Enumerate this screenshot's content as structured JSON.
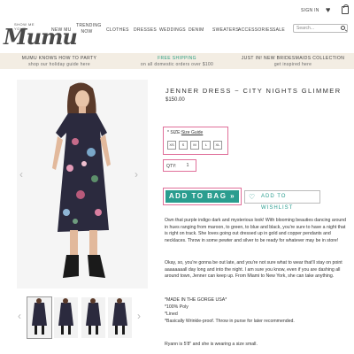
{
  "brand": {
    "logo_text": "Mumu",
    "tagline": "SHOW ME YOUR"
  },
  "nav": {
    "items": [
      "NEW MU",
      "TRENDING NOW",
      "CLOTHES",
      "DRESSES",
      "WEDDINGS",
      "DENIM",
      "SWEATERS",
      "ACCESSORIES",
      "SALE"
    ]
  },
  "utility": {
    "sign_in": "SIGN IN",
    "search_placeholder": "Search..."
  },
  "promo": [
    {
      "title": "MUMU KNOWS HOW TO PARTY",
      "subtitle": "shop our holiday guide here"
    },
    {
      "title": "FREE SHIPPING",
      "subtitle": "on all domestic orders over $100"
    },
    {
      "title": "JUST IN! NEW BRIDESMAIDS COLLECTION",
      "subtitle": "get inspired here"
    }
  ],
  "product": {
    "title": "JENNER DRESS ~ CITY NIGHTS GLIMMER",
    "price": "$150.00",
    "size_label": "* SIZE:",
    "size_guide": "Size Guide",
    "sizes": [
      "XS",
      "S",
      "M",
      "L",
      "XL"
    ],
    "qty_label": "QTY:",
    "qty_value": "1",
    "add_to_bag": "ADD TO BAG »",
    "wishlist": "ADD TO WISHLIST"
  },
  "description": {
    "p1": "Own that purple indigo dark and mysterious look! With blooming beauties dancing around in hues ranging from maroon, to green, to blue and black, you're sure to have a night that is right on track. She loves going out dressed up in gold and copper pendants and necklaces. Throw in some pewter and silver to be ready for whatever may be in store!",
    "p2": "Okay, so, you're gonna be out late, and you're not sure what to wear that'll stay on point aaaaaaaall day long and into the night. I am sure you know, even if you are dashing all around town, Jenner can keep up. From Miami to New York, she can take anything.",
    "features": [
      "*MADE IN THE GORGE USA*",
      "*100% Poly",
      "*Lined",
      "*Basically Wrinkle-proof. Throw in purse for later recommended."
    ],
    "model": "Ryann is 5'8\" and she is wearing a size small."
  },
  "icons": {
    "heart": "heart-icon",
    "bag": "bag-icon",
    "search": "search-icon",
    "prev": "chevron-left-icon",
    "next": "chevron-right-icon"
  },
  "colors": {
    "accent": "#2a9d8f",
    "highlight": "#e0709a",
    "promo_bg": "#f3ede3"
  }
}
